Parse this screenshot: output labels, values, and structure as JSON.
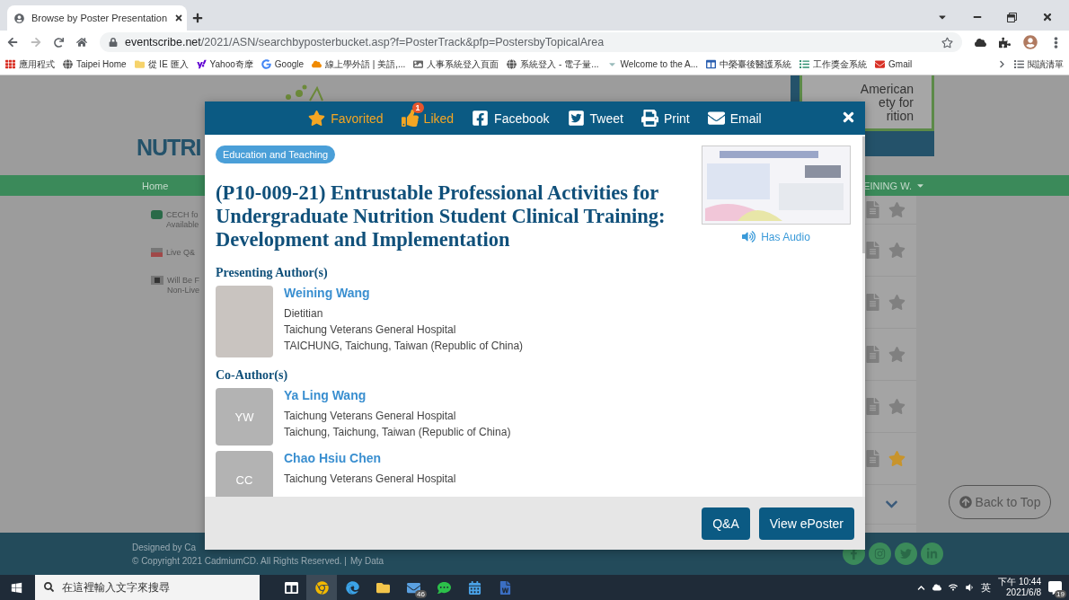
{
  "browser": {
    "tab_title": "Browse by Poster Presentation",
    "url_host": "eventscribe.net",
    "url_path": "/2021/ASN/searchbyposterbucket.asp?f=PosterTrack&pfp=PostersbyTopicalArea",
    "bookmarks": [
      {
        "label": "應用程式",
        "kind": "apps"
      },
      {
        "label": "Taipei Home",
        "kind": "globe"
      },
      {
        "label": "從 IE 匯入",
        "kind": "folder"
      },
      {
        "label": "Yahoo奇摩",
        "kind": "yahoo"
      },
      {
        "label": "Google",
        "kind": "google"
      },
      {
        "label": "線上學外語 | 美語,...",
        "kind": "orange"
      },
      {
        "label": "人事系統登入頁面",
        "kind": "picture"
      },
      {
        "label": "系統登入 - 電子量...",
        "kind": "globe"
      },
      {
        "label": "Welcome to the A...",
        "kind": "w"
      },
      {
        "label": "中榮臺後醫護系統",
        "kind": "b"
      },
      {
        "label": "工作獎金系統",
        "kind": "green"
      },
      {
        "label": "Gmail",
        "kind": "gmail"
      }
    ],
    "reading_list": "閱讀清單"
  },
  "page": {
    "logo_text": "NUTRI",
    "partner_lines": [
      "American",
      "ety for",
      "rition"
    ],
    "nav_home": "Home",
    "nav_user": "EINING W.",
    "side_items": [
      {
        "kind": "cech",
        "lines": [
          "CECH fo",
          "Available"
        ]
      },
      {
        "kind": "live",
        "lines": [
          "Live Q&"
        ]
      },
      {
        "kind": "record",
        "lines": [
          "Will Be F",
          "Non-Live"
        ]
      }
    ],
    "poster_rows": [
      {
        "favorited": false
      },
      {
        "favorited": false
      },
      {
        "favorited": false
      },
      {
        "favorited": false
      },
      {
        "favorited": false
      },
      {
        "favorited": true
      }
    ],
    "back_to_top": "Back to Top",
    "footer_designed": "Designed by Ca",
    "footer_copyright": "© Copyright 2021 CadmiumCD. All Rights Reserved. |",
    "footer_link": "My Data"
  },
  "modal": {
    "actions": [
      {
        "kind": "favorite",
        "label": "Favorited",
        "active": true
      },
      {
        "kind": "like",
        "label": "Liked",
        "active": true,
        "badge": "1"
      },
      {
        "kind": "facebook",
        "label": "Facebook",
        "active": false
      },
      {
        "kind": "twitter",
        "label": "Tweet",
        "active": false
      },
      {
        "kind": "print",
        "label": "Print",
        "active": false
      },
      {
        "kind": "email",
        "label": "Email",
        "active": false
      }
    ],
    "category": "Education and Teaching",
    "title": "(P10-009-21) Entrustable Professional Activities for Undergraduate Nutrition Student Clinical Training: Development and Implementation",
    "audio_label": "Has Audio",
    "presenting_heading": "Presenting Author(s)",
    "presenting": [
      {
        "name": "Weining Wang",
        "lines": [
          "Dietitian",
          "Taichung Veterans General Hospital",
          "TAICHUNG, Taichung, Taiwan (Republic of China)"
        ]
      }
    ],
    "coauthor_heading": "Co-Author(s)",
    "coauthors": [
      {
        "initials": "YW",
        "name": "Ya Ling Wang",
        "lines": [
          "Taichung Veterans General Hospital",
          "Taichung, Taichung, Taiwan (Republic of China)"
        ]
      },
      {
        "initials": "CC",
        "name": "Chao Hsiu Chen",
        "lines": [
          "Taichung Veterans General Hospital"
        ]
      }
    ],
    "buttons": [
      "Q&A",
      "View ePoster"
    ]
  },
  "taskbar": {
    "search_placeholder": "在這裡輸入文字來搜尋",
    "apps": [
      {
        "kind": "taskview",
        "active": false
      },
      {
        "kind": "chrome",
        "active": true
      },
      {
        "kind": "edge",
        "active": false
      },
      {
        "kind": "explorer",
        "active": false
      },
      {
        "kind": "mail",
        "active": false,
        "badge": "46"
      },
      {
        "kind": "line",
        "active": false
      },
      {
        "kind": "calendar",
        "active": false
      },
      {
        "kind": "word",
        "active": false
      }
    ],
    "ime": "英",
    "time": "下午 10:44",
    "date": "2021/6/8",
    "notifications": "19"
  }
}
